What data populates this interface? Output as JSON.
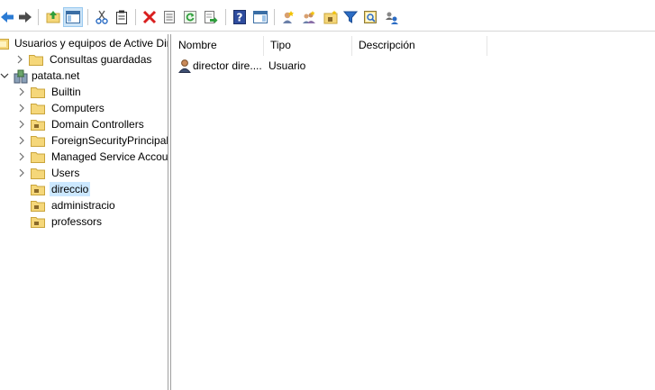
{
  "toolbar": {
    "buttons": [
      {
        "icon": "back-arrow-icon"
      },
      {
        "icon": "forward-arrow-icon"
      },
      {
        "icon": "up-level-icon"
      },
      {
        "icon": "show-hide-console-tree-icon",
        "pressed": true
      },
      {
        "icon": "cut-icon"
      },
      {
        "icon": "copy-icon"
      },
      {
        "icon": "delete-icon"
      },
      {
        "icon": "properties-icon"
      },
      {
        "icon": "refresh-icon"
      },
      {
        "icon": "export-list-icon"
      },
      {
        "icon": "help-icon"
      },
      {
        "icon": "show-hide-action-pane-icon"
      },
      {
        "icon": "new-user-icon"
      },
      {
        "icon": "new-group-icon"
      },
      {
        "icon": "new-ou-icon"
      },
      {
        "icon": "filter-icon"
      },
      {
        "icon": "add-to-group-icon"
      },
      {
        "icon": "delegate-control-icon"
      }
    ]
  },
  "tree": {
    "root": "Usuarios y equipos de Active Directory",
    "saved_queries": "Consultas guardadas",
    "domain": "patata.net",
    "children": [
      {
        "label": "Builtin",
        "expandable": true,
        "type": "container"
      },
      {
        "label": "Computers",
        "expandable": true,
        "type": "container"
      },
      {
        "label": "Domain Controllers",
        "expandable": true,
        "type": "ou"
      },
      {
        "label": "ForeignSecurityPrincipals",
        "expandable": true,
        "type": "container"
      },
      {
        "label": "Managed Service Accounts",
        "expandable": true,
        "type": "container"
      },
      {
        "label": "Users",
        "expandable": true,
        "type": "container"
      },
      {
        "label": "direccio",
        "expandable": false,
        "type": "ou",
        "selected": true
      },
      {
        "label": "administracio",
        "expandable": false,
        "type": "ou"
      },
      {
        "label": "professors",
        "expandable": false,
        "type": "ou"
      }
    ]
  },
  "list": {
    "columns": [
      "Nombre",
      "Tipo",
      "Descripción"
    ],
    "rows": [
      {
        "name": "director dire....",
        "type": "Usuario",
        "description": ""
      }
    ]
  },
  "colors": {
    "selection": "#cce8ff",
    "folder": "#f5d77a",
    "folder_border": "#c9a43b"
  }
}
